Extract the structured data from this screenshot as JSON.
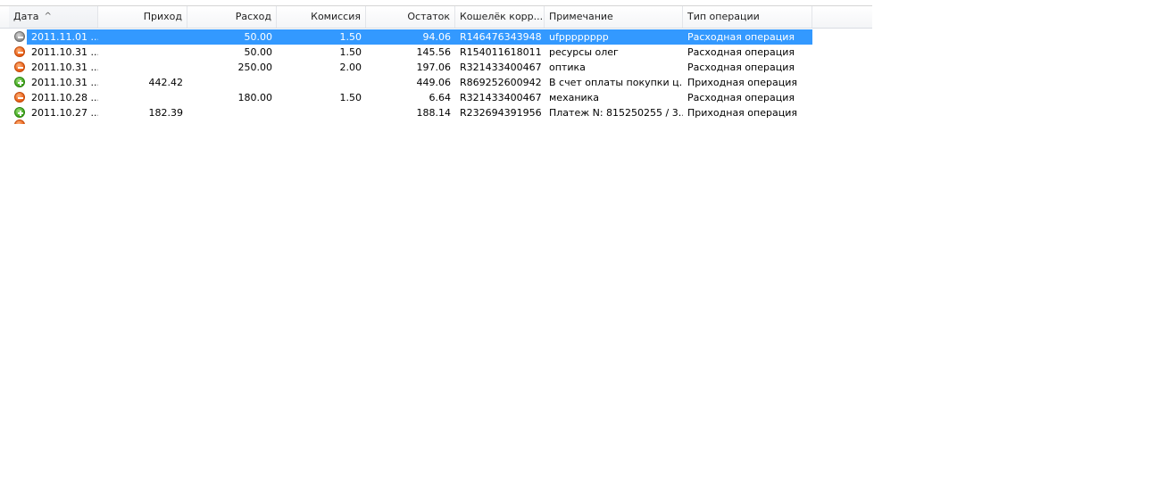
{
  "columns": {
    "date": "Дата",
    "income": "Приход",
    "expense": "Расход",
    "commission": "Комиссия",
    "balance": "Остаток",
    "wallet": "Кошелёк корр...",
    "note": "Примечание",
    "type": "Тип операции"
  },
  "sort_arrow": "^",
  "rows": [
    {
      "date": "2011.11.01 ...",
      "income": "",
      "expense": "50.00",
      "commission": "1.50",
      "balance": "94.06",
      "wallet": "R146476343948",
      "note": "ufpppppppp",
      "type": "Расходная операция",
      "icon": "gray-minus-icon"
    },
    {
      "date": "2011.10.31 ...",
      "income": "",
      "expense": "50.00",
      "commission": "1.50",
      "balance": "145.56",
      "wallet": "R154011618011",
      "note": "ресурсы олег",
      "type": "Расходная операция",
      "icon": "orange-minus-icon"
    },
    {
      "date": "2011.10.31 ...",
      "income": "",
      "expense": "250.00",
      "commission": "2.00",
      "balance": "197.06",
      "wallet": "R321433400467",
      "note": "оптика",
      "type": "Расходная операция",
      "icon": "orange-minus-icon"
    },
    {
      "date": "2011.10.31 ...",
      "income": "442.42",
      "expense": "",
      "commission": "",
      "balance": "449.06",
      "wallet": "R869252600942",
      "note": "В счет оплаты покупки ц...",
      "type": "Приходная операция",
      "icon": "green-plus-icon"
    },
    {
      "date": "2011.10.28 ...",
      "income": "",
      "expense": "180.00",
      "commission": "1.50",
      "balance": "6.64",
      "wallet": "R321433400467",
      "note": "механика",
      "type": "Расходная операция",
      "icon": "orange-minus-icon"
    },
    {
      "date": "2011.10.27 ...",
      "income": "182.39",
      "expense": "",
      "commission": "",
      "balance": "188.14",
      "wallet": "R232694391956",
      "note": "Платеж N: 815250255 / 3...",
      "type": "Приходная операция",
      "icon": "green-plus-icon"
    }
  ],
  "selected_row_index": 0,
  "colors": {
    "selection": "#3399ff",
    "expense_icon": "#e8580f",
    "income_icon": "#3aa317"
  }
}
